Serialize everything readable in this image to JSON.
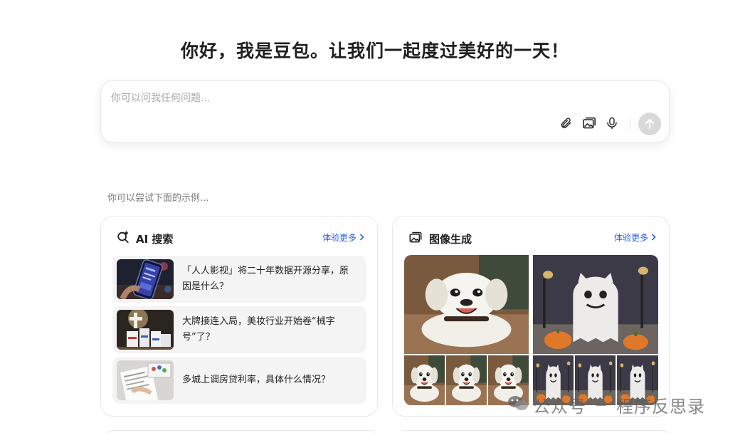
{
  "greeting": "你好，我是豆包。让我们一起度过美好的一天！",
  "chat": {
    "placeholder": "你可以问我任何问题..."
  },
  "examples_label": "你可以尝试下面的示例...",
  "cards": {
    "ai_search": {
      "title": "AI 搜索",
      "more": "体验更多",
      "items": [
        {
          "text": "「人人影视」将二十年数据开源分享，原因是什么？"
        },
        {
          "text": "大牌接连入局，美妆行业开始卷“械字号”了？"
        },
        {
          "text": "多城上调房贷利率，具体什么情况？"
        }
      ]
    },
    "image_gen": {
      "title": "图像生成",
      "more": "体验更多"
    }
  },
  "watermark": {
    "left": "公众号",
    "right": "程序反思录"
  },
  "colors": {
    "accent": "#2b5df0",
    "send_disabled": "#d9d9d9",
    "item_bg": "#f4f4f4"
  }
}
